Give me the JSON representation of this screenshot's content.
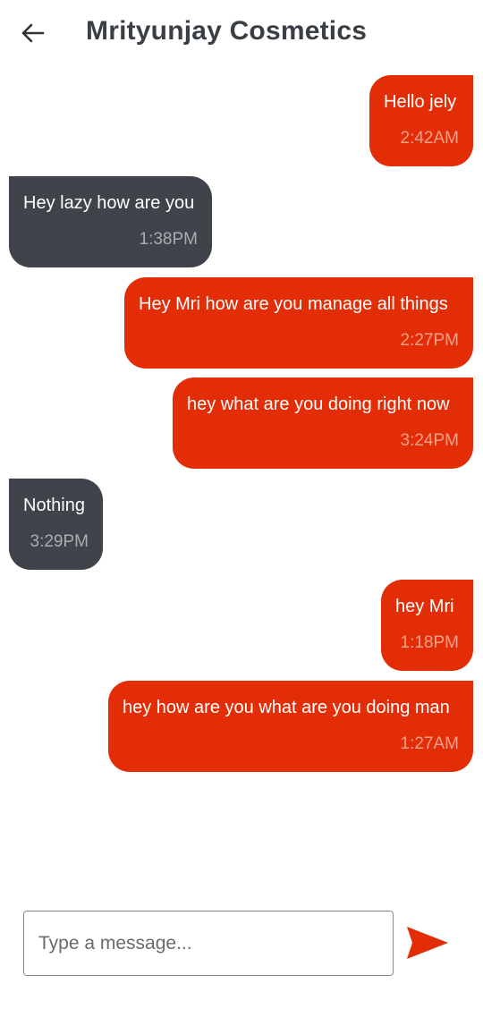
{
  "header": {
    "title": "Mrityunjay Cosmetics",
    "back_icon": "arrow-left-icon"
  },
  "messages": [
    {
      "direction": "sent",
      "text": "Hello jely",
      "time": "2:42AM"
    },
    {
      "direction": "received",
      "text": "Hey lazy how are you",
      "time": "1:38PM"
    },
    {
      "direction": "sent",
      "text": "Hey Mri how are you manage all things",
      "time": "2:27PM"
    },
    {
      "direction": "sent",
      "text": "hey what are you doing right now",
      "time": "3:24PM"
    },
    {
      "direction": "received",
      "text": "Nothing",
      "time": "3:29PM"
    },
    {
      "direction": "sent",
      "text": "hey Mri",
      "time": "1:18PM"
    },
    {
      "direction": "sent",
      "text": "hey how are you what are you doing man",
      "time": "1:27AM"
    }
  ],
  "composer": {
    "placeholder": "Type a message...",
    "value": "",
    "send_icon": "send-icon"
  },
  "colors": {
    "sent_bubble": "#e32d07",
    "received_bubble": "#3f444a",
    "title": "#3a3f46"
  }
}
